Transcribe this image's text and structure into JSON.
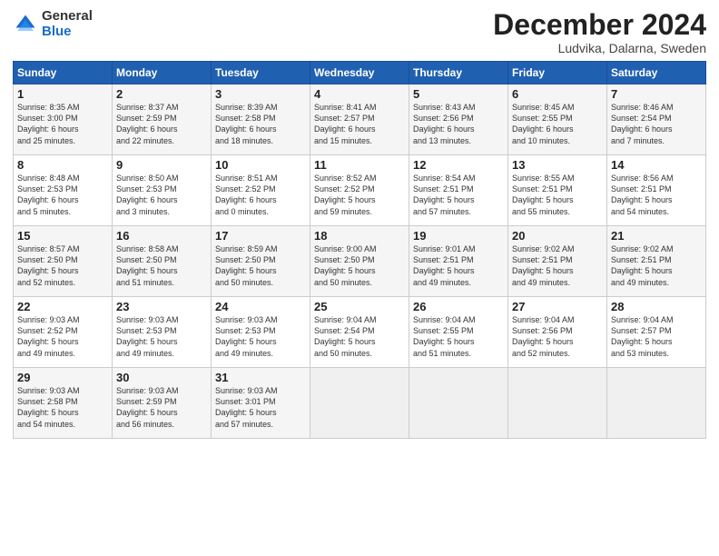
{
  "header": {
    "logo_general": "General",
    "logo_blue": "Blue",
    "month_title": "December 2024",
    "subtitle": "Ludvika, Dalarna, Sweden"
  },
  "days_of_week": [
    "Sunday",
    "Monday",
    "Tuesday",
    "Wednesday",
    "Thursday",
    "Friday",
    "Saturday"
  ],
  "weeks": [
    [
      {
        "day": "1",
        "info": "Sunrise: 8:35 AM\nSunset: 3:00 PM\nDaylight: 6 hours\nand 25 minutes."
      },
      {
        "day": "2",
        "info": "Sunrise: 8:37 AM\nSunset: 2:59 PM\nDaylight: 6 hours\nand 22 minutes."
      },
      {
        "day": "3",
        "info": "Sunrise: 8:39 AM\nSunset: 2:58 PM\nDaylight: 6 hours\nand 18 minutes."
      },
      {
        "day": "4",
        "info": "Sunrise: 8:41 AM\nSunset: 2:57 PM\nDaylight: 6 hours\nand 15 minutes."
      },
      {
        "day": "5",
        "info": "Sunrise: 8:43 AM\nSunset: 2:56 PM\nDaylight: 6 hours\nand 13 minutes."
      },
      {
        "day": "6",
        "info": "Sunrise: 8:45 AM\nSunset: 2:55 PM\nDaylight: 6 hours\nand 10 minutes."
      },
      {
        "day": "7",
        "info": "Sunrise: 8:46 AM\nSunset: 2:54 PM\nDaylight: 6 hours\nand 7 minutes."
      }
    ],
    [
      {
        "day": "8",
        "info": "Sunrise: 8:48 AM\nSunset: 2:53 PM\nDaylight: 6 hours\nand 5 minutes."
      },
      {
        "day": "9",
        "info": "Sunrise: 8:50 AM\nSunset: 2:53 PM\nDaylight: 6 hours\nand 3 minutes."
      },
      {
        "day": "10",
        "info": "Sunrise: 8:51 AM\nSunset: 2:52 PM\nDaylight: 6 hours\nand 0 minutes."
      },
      {
        "day": "11",
        "info": "Sunrise: 8:52 AM\nSunset: 2:52 PM\nDaylight: 5 hours\nand 59 minutes."
      },
      {
        "day": "12",
        "info": "Sunrise: 8:54 AM\nSunset: 2:51 PM\nDaylight: 5 hours\nand 57 minutes."
      },
      {
        "day": "13",
        "info": "Sunrise: 8:55 AM\nSunset: 2:51 PM\nDaylight: 5 hours\nand 55 minutes."
      },
      {
        "day": "14",
        "info": "Sunrise: 8:56 AM\nSunset: 2:51 PM\nDaylight: 5 hours\nand 54 minutes."
      }
    ],
    [
      {
        "day": "15",
        "info": "Sunrise: 8:57 AM\nSunset: 2:50 PM\nDaylight: 5 hours\nand 52 minutes."
      },
      {
        "day": "16",
        "info": "Sunrise: 8:58 AM\nSunset: 2:50 PM\nDaylight: 5 hours\nand 51 minutes."
      },
      {
        "day": "17",
        "info": "Sunrise: 8:59 AM\nSunset: 2:50 PM\nDaylight: 5 hours\nand 50 minutes."
      },
      {
        "day": "18",
        "info": "Sunrise: 9:00 AM\nSunset: 2:50 PM\nDaylight: 5 hours\nand 50 minutes."
      },
      {
        "day": "19",
        "info": "Sunrise: 9:01 AM\nSunset: 2:51 PM\nDaylight: 5 hours\nand 49 minutes."
      },
      {
        "day": "20",
        "info": "Sunrise: 9:02 AM\nSunset: 2:51 PM\nDaylight: 5 hours\nand 49 minutes."
      },
      {
        "day": "21",
        "info": "Sunrise: 9:02 AM\nSunset: 2:51 PM\nDaylight: 5 hours\nand 49 minutes."
      }
    ],
    [
      {
        "day": "22",
        "info": "Sunrise: 9:03 AM\nSunset: 2:52 PM\nDaylight: 5 hours\nand 49 minutes."
      },
      {
        "day": "23",
        "info": "Sunrise: 9:03 AM\nSunset: 2:53 PM\nDaylight: 5 hours\nand 49 minutes."
      },
      {
        "day": "24",
        "info": "Sunrise: 9:03 AM\nSunset: 2:53 PM\nDaylight: 5 hours\nand 49 minutes."
      },
      {
        "day": "25",
        "info": "Sunrise: 9:04 AM\nSunset: 2:54 PM\nDaylight: 5 hours\nand 50 minutes."
      },
      {
        "day": "26",
        "info": "Sunrise: 9:04 AM\nSunset: 2:55 PM\nDaylight: 5 hours\nand 51 minutes."
      },
      {
        "day": "27",
        "info": "Sunrise: 9:04 AM\nSunset: 2:56 PM\nDaylight: 5 hours\nand 52 minutes."
      },
      {
        "day": "28",
        "info": "Sunrise: 9:04 AM\nSunset: 2:57 PM\nDaylight: 5 hours\nand 53 minutes."
      }
    ],
    [
      {
        "day": "29",
        "info": "Sunrise: 9:03 AM\nSunset: 2:58 PM\nDaylight: 5 hours\nand 54 minutes."
      },
      {
        "day": "30",
        "info": "Sunrise: 9:03 AM\nSunset: 2:59 PM\nDaylight: 5 hours\nand 56 minutes."
      },
      {
        "day": "31",
        "info": "Sunrise: 9:03 AM\nSunset: 3:01 PM\nDaylight: 5 hours\nand 57 minutes."
      },
      null,
      null,
      null,
      null
    ]
  ]
}
